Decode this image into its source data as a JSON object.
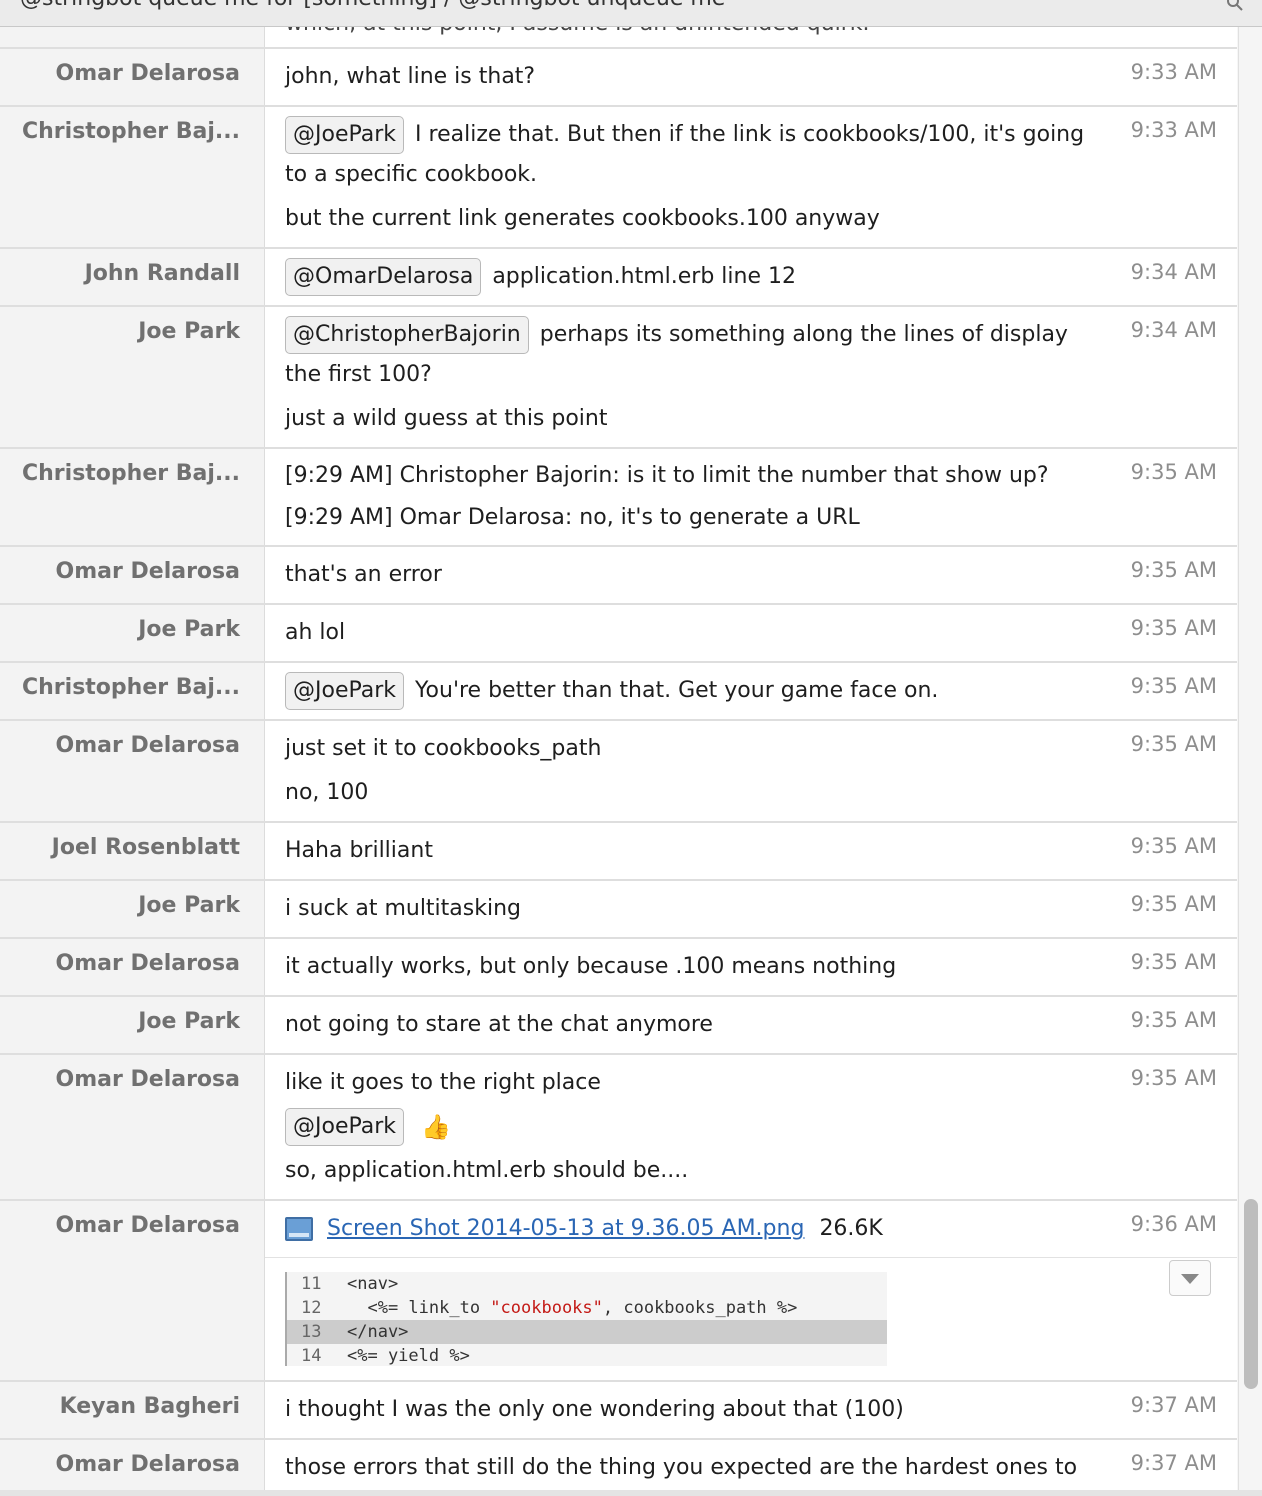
{
  "top_fragment": {
    "title_text": "@stringbot queue me for [something] / @stringbot unqueue me",
    "search_icon": "search-icon"
  },
  "fragment_line": "which, at this point, I assume is an unintended quirk.",
  "messages": [
    {
      "author": "Omar Delarosa",
      "time": "9:33 AM",
      "lines": [
        {
          "text": "john, what line is that?"
        }
      ]
    },
    {
      "author": "Christopher Baj...",
      "time": "9:33 AM",
      "lines": [
        {
          "mention": "@JoePark",
          "text": "I realize that. But then if the link is cookbooks/100, it's going to a specific cookbook."
        },
        {
          "text": "but the current link generates cookbooks.100 anyway"
        }
      ]
    },
    {
      "author": "John Randall",
      "time": "9:34 AM",
      "lines": [
        {
          "mention": "@OmarDelarosa",
          "text": "application.html.erb line 12"
        }
      ]
    },
    {
      "author": "Joe Park",
      "time": "9:34 AM",
      "lines": [
        {
          "mention": "@ChristopherBajorin",
          "text": "perhaps its something along the lines of display the first 100?"
        },
        {
          "text": "just a wild guess at this point"
        }
      ]
    },
    {
      "author": "Christopher Baj...",
      "time": "9:35 AM",
      "tight": true,
      "lines": [
        {
          "text": "[9:29 AM] Christopher Bajorin: is it to limit the number that show up?"
        },
        {
          "text": "[9:29 AM] Omar Delarosa: no, it's to generate a URL"
        }
      ]
    },
    {
      "author": "Omar Delarosa",
      "time": "9:35 AM",
      "lines": [
        {
          "text": "that's an error"
        }
      ]
    },
    {
      "author": "Joe Park",
      "time": "9:35 AM",
      "lines": [
        {
          "text": "ah lol"
        }
      ]
    },
    {
      "author": "Christopher Baj...",
      "time": "9:35 AM",
      "lines": [
        {
          "mention": "@JoePark",
          "text": "You're better than that. Get your game face on."
        }
      ]
    },
    {
      "author": "Omar Delarosa",
      "time": "9:35 AM",
      "lines": [
        {
          "text": "just set it to cookbooks_path"
        },
        {
          "text": "no, 100"
        }
      ]
    },
    {
      "author": "Joel Rosenblatt",
      "time": "9:35 AM",
      "lines": [
        {
          "text": "Haha brilliant"
        }
      ]
    },
    {
      "author": "Joe Park",
      "time": "9:35 AM",
      "lines": [
        {
          "text": "i suck at multitasking"
        }
      ]
    },
    {
      "author": "Omar Delarosa",
      "time": "9:35 AM",
      "lines": [
        {
          "text": "it actually works, but only because .100 means nothing"
        }
      ]
    },
    {
      "author": "Joe Park",
      "time": "9:35 AM",
      "lines": [
        {
          "text": "not going to stare at the chat anymore"
        }
      ]
    },
    {
      "author": "Omar Delarosa",
      "time": "9:35 AM",
      "lines": [
        {
          "text": "like it goes to the right place"
        },
        {
          "mention": "@JoePark",
          "text": "",
          "thumb": "👍"
        },
        {
          "text": "so, application.html.erb should be...."
        }
      ]
    }
  ],
  "file_message": {
    "author": "Omar Delarosa",
    "time": "9:36 AM",
    "file_name": "Screen Shot 2014-05-13 at 9.36.05 AM.png",
    "file_size": "26.6K",
    "file_icon": "image-file-icon",
    "expand_icon": "chevron-down-icon",
    "code_lines": [
      {
        "num": "11",
        "before": "<nav>",
        "string": "",
        "after": "",
        "highlight": false
      },
      {
        "num": "12",
        "before": "  <%= link_to ",
        "string": "\"cookbooks\"",
        "after": ", cookbooks_path %>",
        "highlight": false
      },
      {
        "num": "13",
        "before": "</nav>",
        "string": "",
        "after": "",
        "highlight": true
      },
      {
        "num": "14",
        "before": "<%= yield %>",
        "string": "",
        "after": "",
        "highlight": false
      }
    ]
  },
  "messages_after": [
    {
      "author": "Keyan Bagheri",
      "time": "9:37 AM",
      "lines": [
        {
          "text": "i thought I was the only one wondering about that (100)"
        }
      ]
    },
    {
      "author": "Omar Delarosa",
      "time": "9:37 AM",
      "lines": [
        {
          "text": "those errors that still do the thing you expected are the hardest ones to spot"
        }
      ]
    }
  ]
}
